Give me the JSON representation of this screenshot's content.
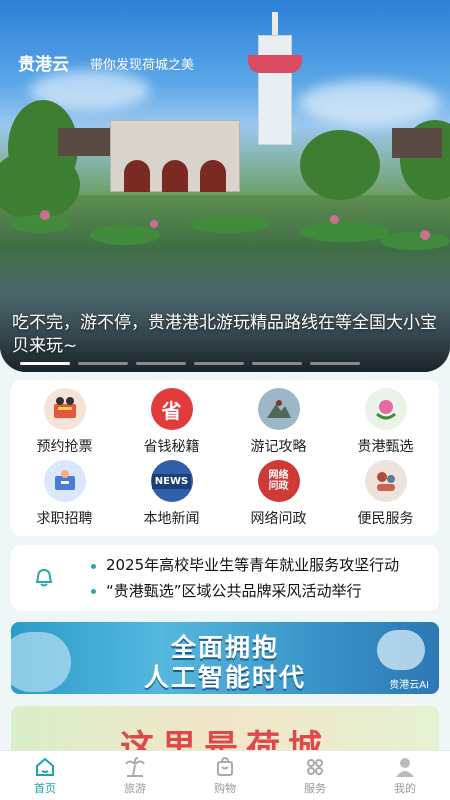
{
  "hero": {
    "brand": "贵港云",
    "slogan": "带你发现荷城之美",
    "caption": "吃不完，游不停，贵港港北游玩精品路线在等全国大小宝贝来玩~"
  },
  "grid": {
    "items": [
      {
        "label": "预约抢票",
        "icon": "movie-ticket-icon",
        "color": "#e8553f"
      },
      {
        "label": "省钱秘籍",
        "icon": "savings-icon",
        "color": "#e23b3b"
      },
      {
        "label": "游记攻略",
        "icon": "travel-notes-icon",
        "color": "#3f6f8f"
      },
      {
        "label": "贵港甄选",
        "icon": "selection-icon",
        "color": "#e9f3ea"
      },
      {
        "label": "求职招聘",
        "icon": "job-icon",
        "color": "#4a7bd8"
      },
      {
        "label": "本地新闻",
        "icon": "news-icon",
        "color": "#2f5fa8"
      },
      {
        "label": "网络问政",
        "icon": "inquiry-icon",
        "color": "#d03a36"
      },
      {
        "label": "便民服务",
        "icon": "service-icon",
        "color": "#b64a3a"
      }
    ]
  },
  "notices": [
    "2025年高校毕业生等青年就业服务攻坚行动",
    "“贵港甄选”区域公共品牌采风活动举行"
  ],
  "ai_banner": {
    "line1": "全面拥抱",
    "line2": "人工智能时代",
    "tag": "贵港云AI"
  },
  "lotus_banner": {
    "text": "这里是荷城"
  },
  "tabbar": [
    {
      "label": "首页",
      "icon": "home-icon",
      "active": true
    },
    {
      "label": "旅游",
      "icon": "palm-tree-icon",
      "active": false
    },
    {
      "label": "购物",
      "icon": "shopping-bag-icon",
      "active": false
    },
    {
      "label": "服务",
      "icon": "services-grid-icon",
      "active": false
    },
    {
      "label": "我的",
      "icon": "profile-icon",
      "active": false
    }
  ],
  "colors": {
    "accent": "#1aa7a7",
    "tab_inactive": "#999999"
  }
}
